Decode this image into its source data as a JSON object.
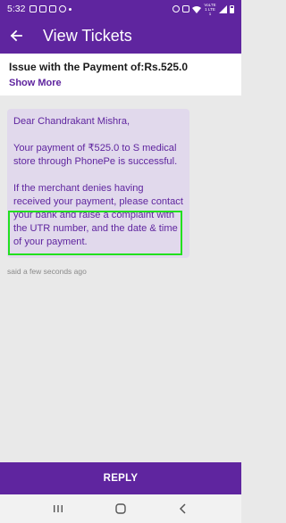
{
  "status_bar": {
    "time": "5:32",
    "network_label": "VoLTE1 LTE1"
  },
  "app_bar": {
    "title": "View Tickets"
  },
  "issue": {
    "title": "Issue with the Payment of:Rs.525.0",
    "show_more": "Show More"
  },
  "message": {
    "greeting": "Dear Chandrakant Mishra,",
    "paragraph1": "Your payment of ₹525.0 to S medical store through PhonePe is successful.",
    "paragraph2": "If the merchant denies having received your payment, please contact your bank and raise a complaint with the UTR number, and the date & time of your payment.",
    "time": "said a few seconds ago"
  },
  "reply": {
    "label": "REPLY"
  },
  "colors": {
    "brand": "#5f259f",
    "bubble": "#e1d9ec",
    "background": "#e9e9e9",
    "highlight": "#22e01f"
  },
  "icons": {
    "back": "arrow-left-icon",
    "nav_recents": "recents-icon",
    "nav_home": "home-icon",
    "nav_back": "back-chevron-icon"
  }
}
